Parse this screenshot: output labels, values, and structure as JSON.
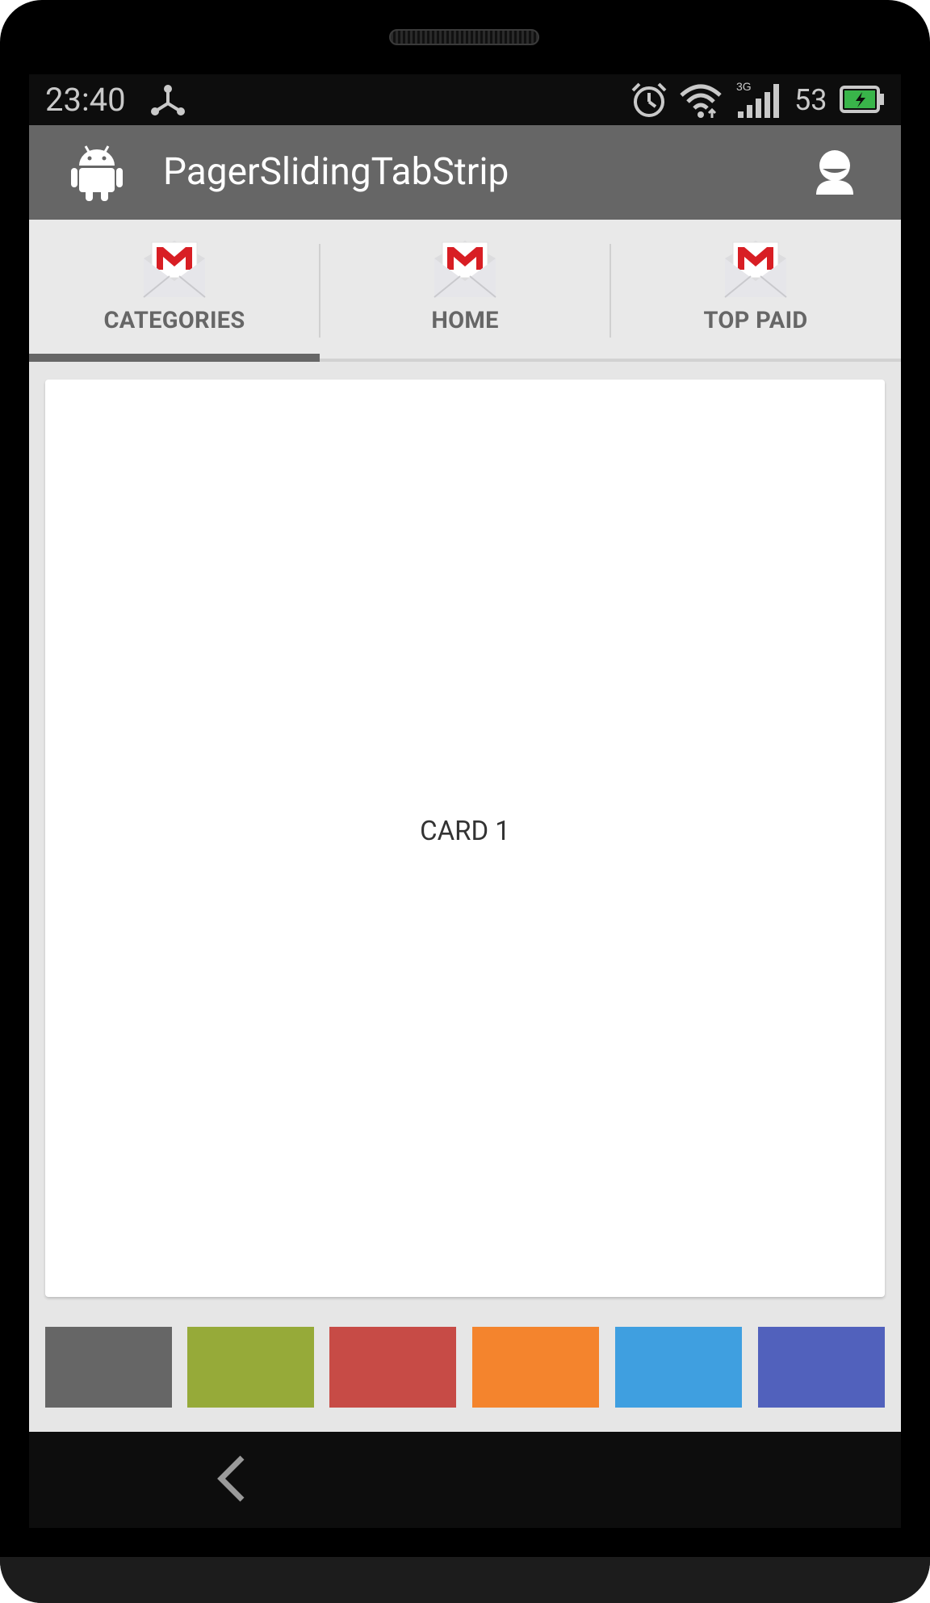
{
  "status_bar": {
    "time": "23:40",
    "battery_level": "53",
    "network_type": "3G"
  },
  "action_bar": {
    "title": "PagerSlidingTabStrip",
    "app_icon": "android-icon",
    "contact_icon": "contact-icon"
  },
  "tabs": [
    {
      "label": "CATEGORIES",
      "icon": "gmail-icon",
      "selected": true
    },
    {
      "label": "HOME",
      "icon": "gmail-icon",
      "selected": false
    },
    {
      "label": "TOP PAID",
      "icon": "gmail-icon",
      "selected": false
    }
  ],
  "card": {
    "label": "CARD 1"
  },
  "colors": {
    "action_bar": "#666666",
    "indicator": "#666666",
    "swatches": [
      "#666666",
      "#96AA39",
      "#C74B46",
      "#F4842D",
      "#3F9FE0",
      "#5161BC"
    ]
  },
  "nav_bar": {
    "back_icon": "back-chevron-icon"
  }
}
